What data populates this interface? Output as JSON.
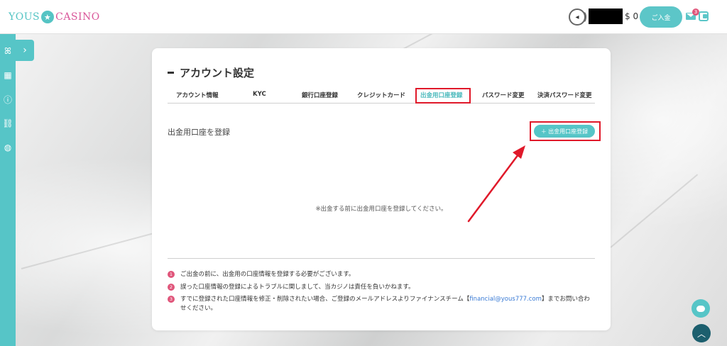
{
  "header": {
    "logo_left": "YOUS",
    "logo_right": "CASINO",
    "balance": "$ 0",
    "deposit_label": "ご入金",
    "mail_badge": "3"
  },
  "page": {
    "title": "アカウント設定",
    "tabs": [
      {
        "label": "アカウント情報"
      },
      {
        "label": "KYC"
      },
      {
        "label": "銀行口座登録"
      },
      {
        "label": "クレジットカード"
      },
      {
        "label": "出金用口座登録",
        "active": true
      },
      {
        "label": "パスワード変更"
      },
      {
        "label": "決済パスワード変更"
      }
    ],
    "section_title": "出金用口座を登録",
    "add_button": "＋ 出金用口座登録",
    "empty_message": "※出金する前に出金用口座を登録してください。",
    "notes": [
      {
        "num": "1",
        "text": "ご出金の前に、出金用の口座情報を登録する必要がございます。"
      },
      {
        "num": "2",
        "text": "誤った口座情報の登録によるトラブルに関しまして、当カジノは責任を負いかねます。"
      },
      {
        "num": "3",
        "text_before": "すでに登録された口座情報を修正・削除されたい場合、ご登録のメールアドレスよりファイナンスチーム【",
        "link": "financial@yous777.com",
        "text_after": "】までお問い合わせください。"
      }
    ]
  },
  "colors": {
    "accent": "#56c5c7",
    "highlight": "#e0192a",
    "badge": "#e0557a",
    "top_button": "#1c5f6e"
  }
}
